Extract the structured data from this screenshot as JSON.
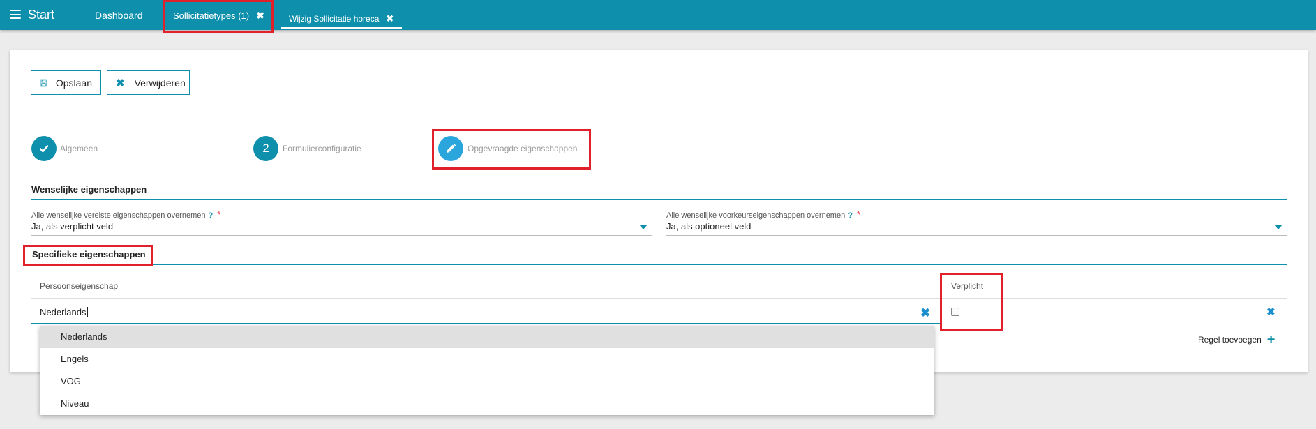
{
  "topbar": {
    "brand": "Start",
    "dashboard": "Dashboard",
    "tabs": [
      {
        "label": "Sollicitatietypes (1)"
      },
      {
        "label": "Wijzig Sollicitatie horeca"
      }
    ]
  },
  "toolbar": {
    "save_label": "Opslaan",
    "delete_label": "Verwijderen"
  },
  "stepper": {
    "steps": [
      {
        "label": "Algemeen",
        "state": "done"
      },
      {
        "label": "Formulierconfiguratie",
        "number": "2",
        "state": "todo"
      },
      {
        "label": "Opgevraagde eigenschappen",
        "state": "current"
      }
    ]
  },
  "desired": {
    "title": "Wenselijke eigenschappen",
    "required_field": {
      "label": "Alle wenselijke vereiste eigenschappen overnemen",
      "help": "?",
      "required_mark": "*",
      "value": "Ja, als verplicht veld"
    },
    "preference_field": {
      "label": "Alle wenselijke voorkeurseigenschappen overnemen",
      "help": "?",
      "required_mark": "*",
      "value": "Ja, als optioneel veld"
    }
  },
  "specific": {
    "title": "Specifieke eigenschappen",
    "col_property": "Persoonseigenschap",
    "col_required": "Verplicht",
    "row_value": "Nederlands",
    "add_row_label": "Regel toevoegen"
  },
  "dropdown": {
    "options": [
      "Nederlands",
      "Engels",
      "VOG",
      "Niveau"
    ],
    "highlighted": "Nederlands"
  },
  "colors": {
    "primary": "#0e8fab",
    "accent": "#2aa6dd",
    "annotation": "#e0202a"
  }
}
